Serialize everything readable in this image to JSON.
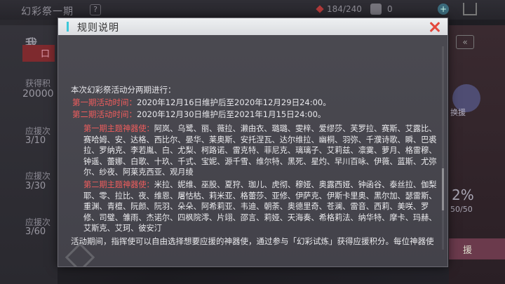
{
  "background": {
    "title": "幻彩祭一期",
    "help_icon_text": "?",
    "resource_count": "184/240",
    "resource2_count": "0",
    "plus_label": "+",
    "left": {
      "heading": "我",
      "badge": "口",
      "label1": "获得积",
      "value1": "20000",
      "label2": "应援次",
      "value2": "3/10",
      "label3": "应援次",
      "value3": "3/30",
      "label4": "应援次",
      "value4": "3/60"
    },
    "right": {
      "arrow": "«",
      "button_label": "换援",
      "percent": "2%",
      "count": "50/50",
      "pink_label": "援"
    }
  },
  "modal": {
    "title": "规则说明",
    "cutoff_top": "·  ·····",
    "intro": "本次幻彩祭活动分两期进行：",
    "phase1": {
      "label": "第一期活动时间：",
      "value": "2020年12月16日维护后至2020年12月29日24:00。"
    },
    "phase2": {
      "label": "第二期活动时间：",
      "value": "2020年12月30日维护后至2021年1月15日24:00。"
    },
    "gods1": {
      "label": "第一期主题神器使：",
      "names": "阿岚、乌鹭、丽、薇拉、濑由衣、璐璐、雯梓、爱缪莎、芙罗拉、赛斯、艾露比、赛哈姆、安、达格、西比尔、晏华、莱奥斯、安托涅瓦、达尔维拉、幽桐、羽弥、千濮诗歌、瞬、巴裘拉、罗纳克、李若胤、白、尤梨、柯路诺、雷克特、菲尼克、璃璃子、艾莉兹、凛霙、萝月、格雷穆、钟遥、蕾娜、白歌、十玖、千式、宝妮、源千雪、维尔特、黑死、星灼、早川百咏、伊薇、蓝斯、尤弥尔、纱夜、阿莱克西亚、观月绫"
    },
    "gods2": {
      "label": "第二期主题神器使：",
      "names": "米拉、妮维、巫股、夏狩、珈儿、虎彻、穆娅、奥露西娅、钟函谷、泰丝拉、伽梨耶、零、拉比、夜、维恩、屠怙枯、莉米亚、格蕾莎、亚修、伊萨克、伊斯卡里奥、黑尔加、瑟雷斯、重渊、青檀、阮颜、阮羽、朵朵、阿希莉亚、韦迪、朝荼、奥德里奇、苍澜、雷音、西莉、美咲、罗修、司璧、雏雨、杰诺尔、四枫院澪、片翊、邵言、莉娅、天海奏、希格莉法、纳华特、摩卡、玛赫、艾斯克、艾珂、彼安汀"
    },
    "note": "活动期间，指挥使可以自由选择想要应援的神器使，通过参与「幻彩试炼」获得应援积分。每位神器使都会根据应援积分排出各自的应援榜。"
  }
}
